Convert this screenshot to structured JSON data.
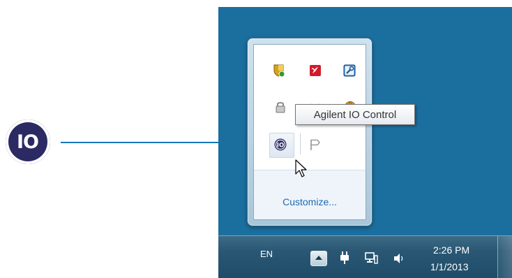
{
  "callout": {
    "icon_name": "agilent-io-icon",
    "icon_text": "IO",
    "line_color": "#1676b8"
  },
  "tray_popup": {
    "icons": [
      "shield-update-icon",
      "red-app-icon",
      "wrench-tool-icon",
      "lock-icon",
      "wireless-icon",
      "globe-icon",
      "agilent-io-icon",
      "flag-icon"
    ],
    "customize_label": "Customize..."
  },
  "tooltip": {
    "text": "Agilent IO Control"
  },
  "taskbar": {
    "language": "EN",
    "icons": [
      "show-hidden-icons",
      "power-plug-icon",
      "network-icon",
      "speaker-icon"
    ],
    "clock_time": "2:26 PM",
    "clock_date": "1/1/2013",
    "color": "#2a5874"
  },
  "desktop_color": "#1b6f9f"
}
